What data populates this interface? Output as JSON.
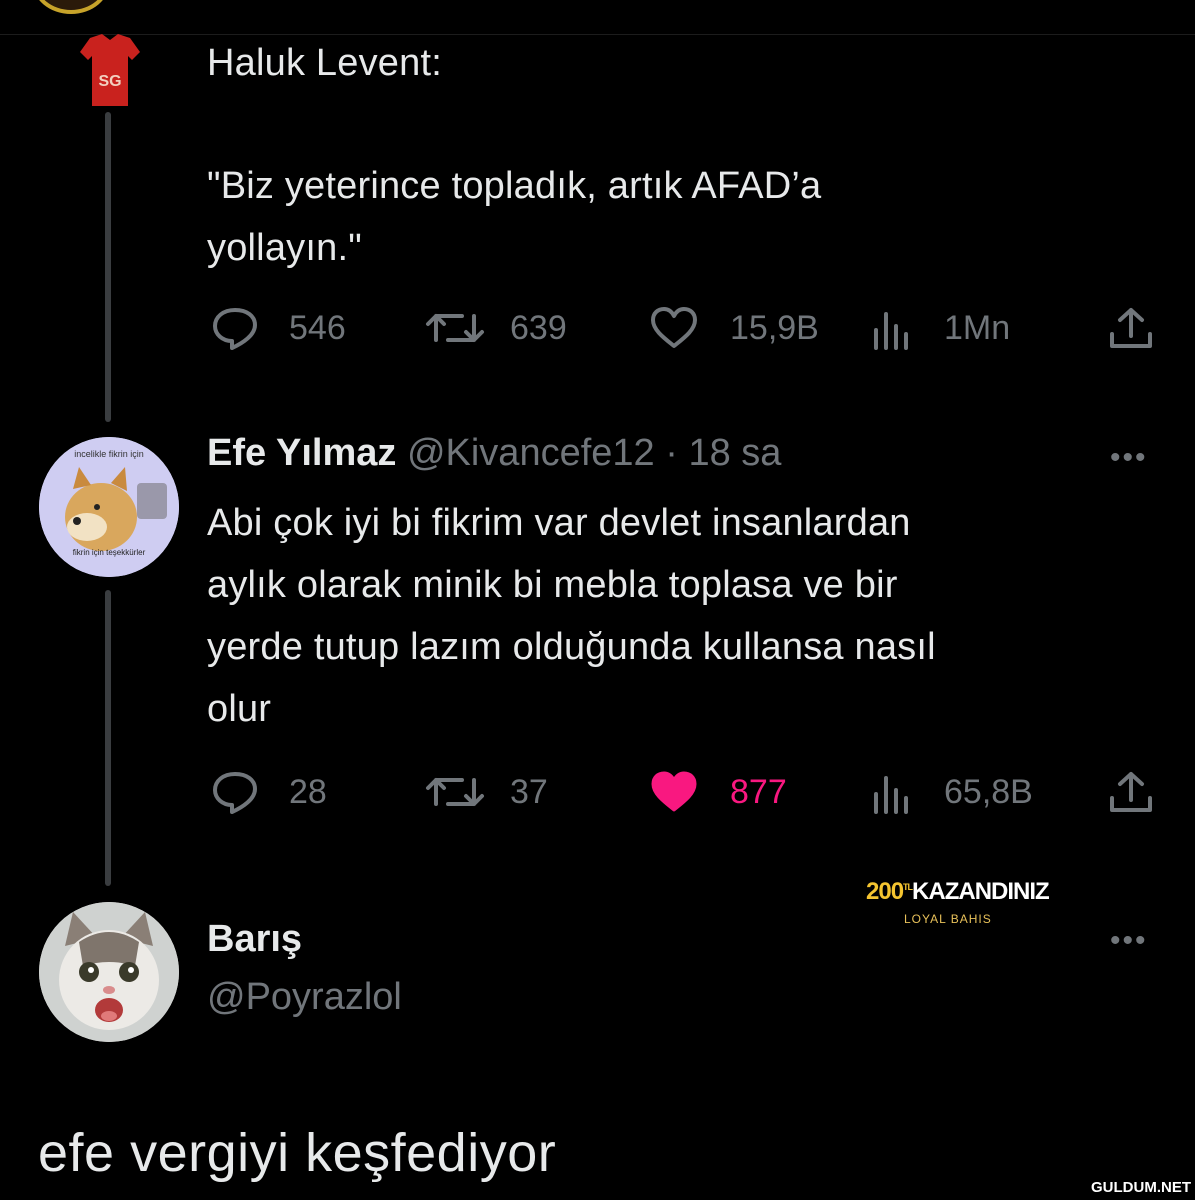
{
  "tweet1": {
    "name": "Haluk Levent:",
    "avatar_badge": "SG",
    "lines": [
      "\"Biz yeterince topladık, artık AFAD’a",
      "yollayın.\""
    ],
    "reply_count": "546",
    "retweet_count": "639",
    "like_count": "15,9B",
    "view_count": "1Mn"
  },
  "tweet2": {
    "author_name": "Efe Yılmaz",
    "author_meta": " @Kivancefe12 · 18 sa",
    "avatar_caption_top": "incelikle fikrin için",
    "avatar_caption_bottom": "fikrin için teşekkürler",
    "lines": [
      "Abi çok iyi bi fikrim var devlet insanlardan",
      "aylık olarak minik bi mebla toplasa ve bir",
      "yerde tutup lazım olduğunda kullansa nasıl",
      "olur"
    ],
    "reply_count": "28",
    "retweet_count": "37",
    "like_count": "877",
    "view_count": "65,8B",
    "liked": true
  },
  "baris": {
    "name": "Barış",
    "handle": "@Poyrazlol"
  },
  "ad": {
    "amount": "200",
    "currency": "TL",
    "text": "KAZANDINIZ",
    "brand": "LOYAL BAHIS"
  },
  "caption": "efe vergiyi keşfediyor",
  "watermark": "GULDUM.NET",
  "more_label": "•••",
  "colors": {
    "background": "#000000",
    "text": "#e7e9ea",
    "muted": "#71767b",
    "like": "#f91880"
  }
}
